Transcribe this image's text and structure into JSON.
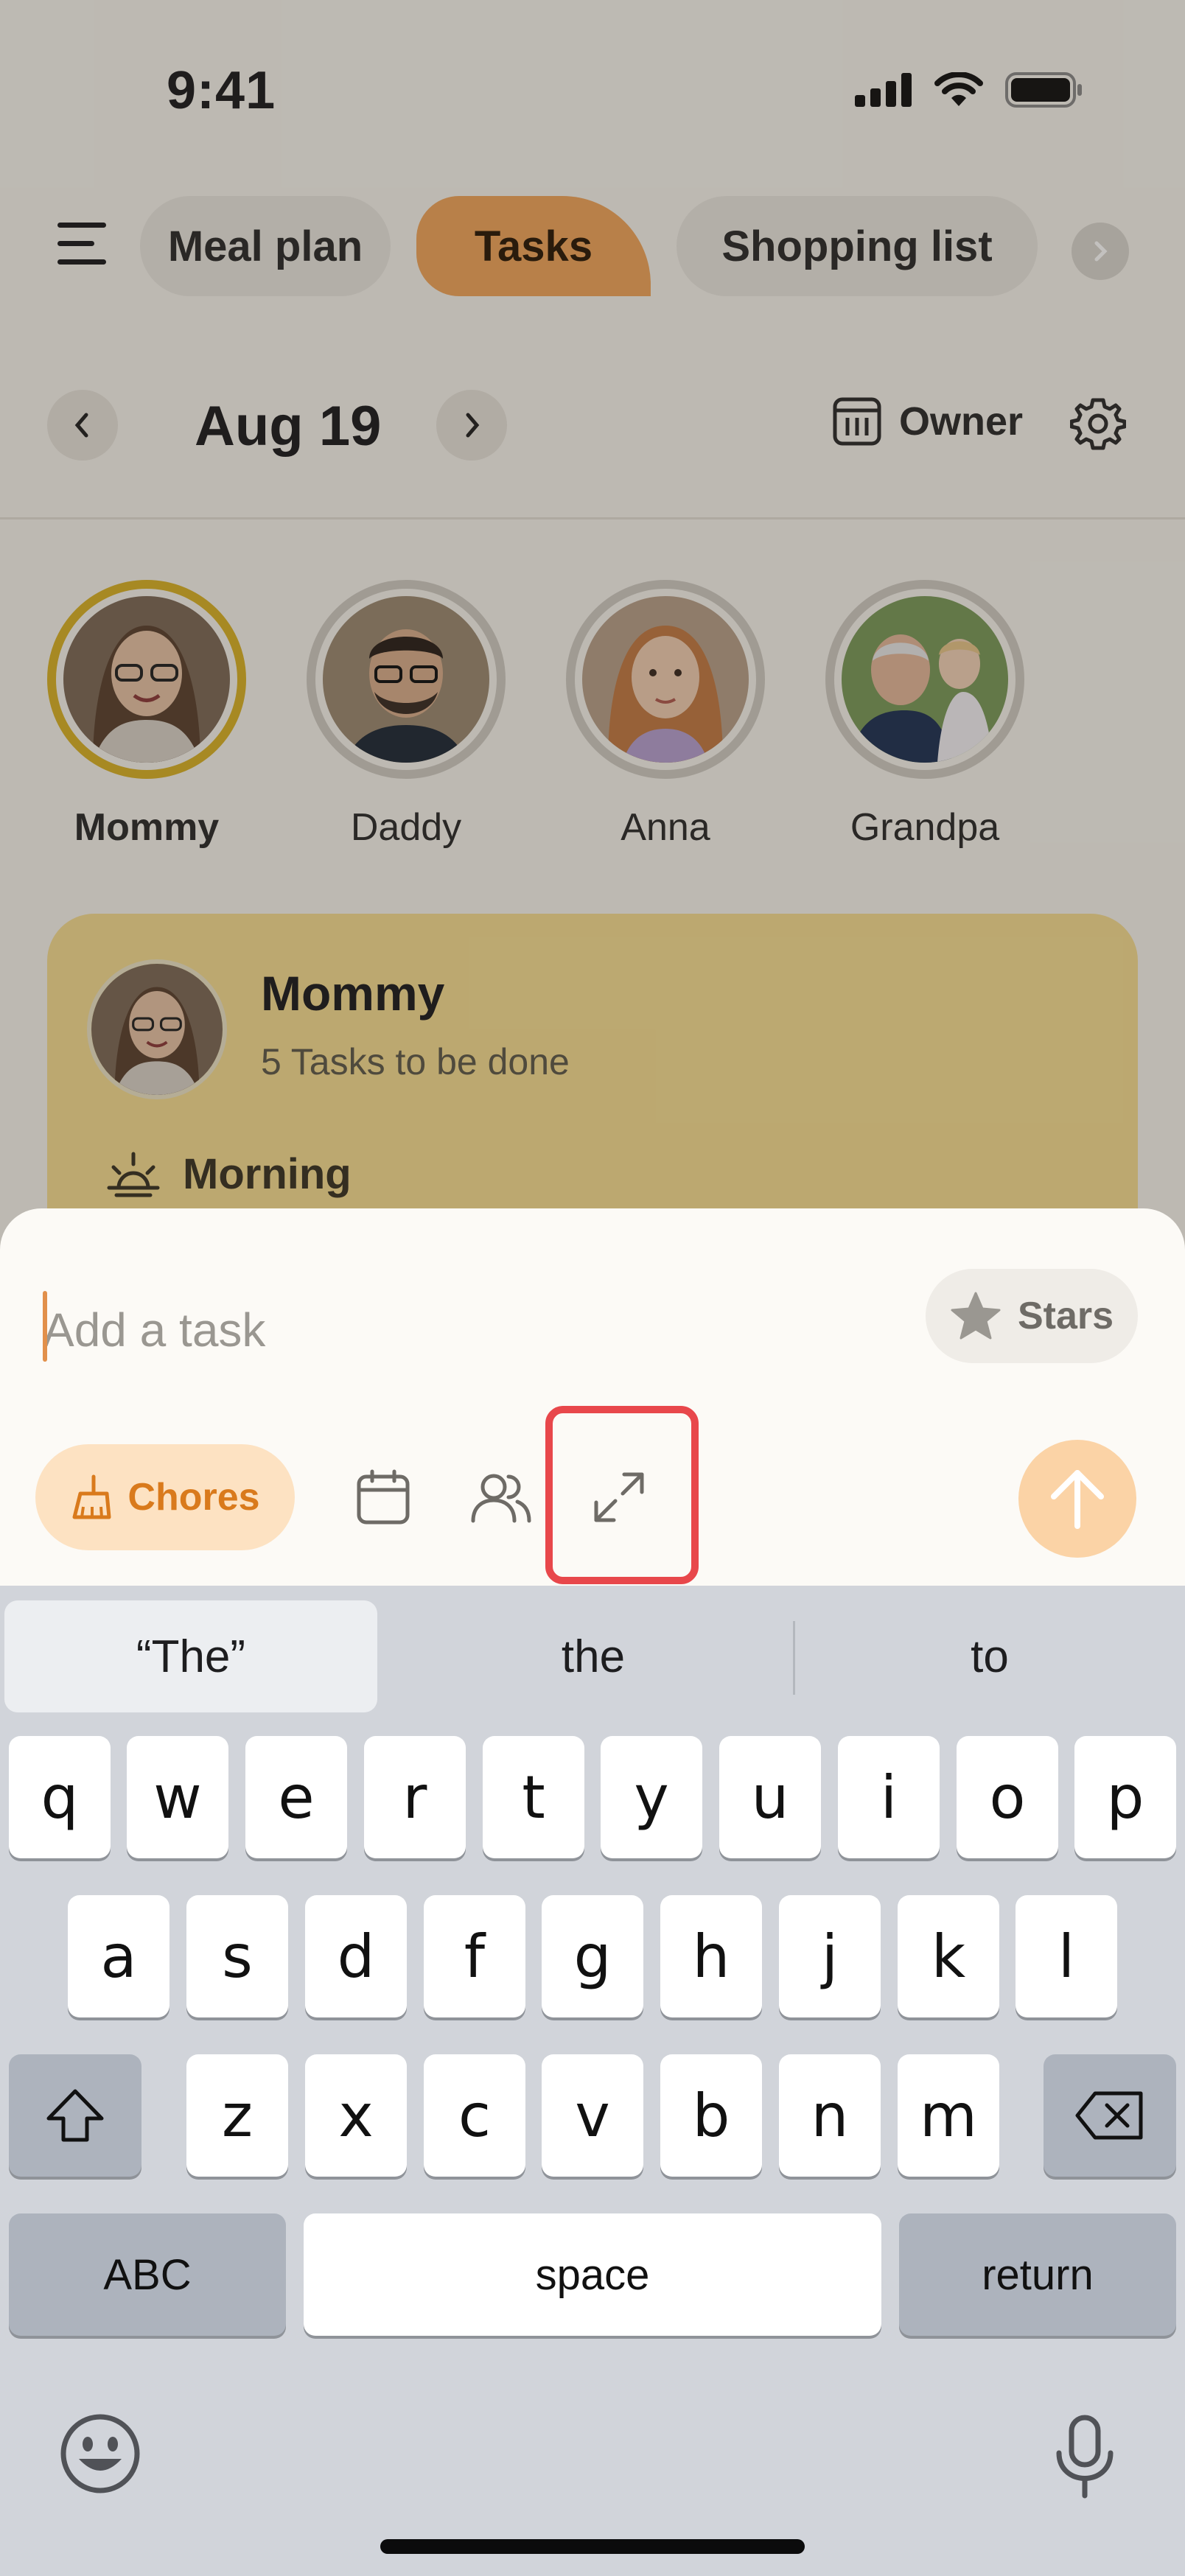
{
  "status_bar": {
    "time": "9:41"
  },
  "tabs": [
    {
      "label": "Meal plan",
      "selected": false
    },
    {
      "label": "Tasks",
      "selected": true
    },
    {
      "label": "Shopping list",
      "selected": false
    }
  ],
  "date_nav": {
    "date": "Aug 19",
    "owner_label": "Owner"
  },
  "members": [
    {
      "name": "Mommy",
      "selected": true
    },
    {
      "name": "Daddy",
      "selected": false
    },
    {
      "name": "Anna",
      "selected": false
    },
    {
      "name": "Grandpa",
      "selected": false
    }
  ],
  "card": {
    "name": "Mommy",
    "subtitle": "5 Tasks to be done",
    "section": "Morning"
  },
  "composer": {
    "placeholder": "Add a task",
    "value": "",
    "stars_label": "Stars",
    "category_label": "Chores"
  },
  "keyboard": {
    "suggestions": [
      "“The”",
      "the",
      "to"
    ],
    "row1": [
      "q",
      "w",
      "e",
      "r",
      "t",
      "y",
      "u",
      "i",
      "o",
      "p"
    ],
    "row2": [
      "a",
      "s",
      "d",
      "f",
      "g",
      "h",
      "j",
      "k",
      "l"
    ],
    "row3": [
      "z",
      "x",
      "c",
      "v",
      "b",
      "n",
      "m"
    ],
    "abc_label": "ABC",
    "space_label": "space",
    "return_label": "return"
  },
  "colors": {
    "accent": "#f0a65c",
    "chip_text": "#d97a1c",
    "highlight": "#e8474b",
    "card": "#f5dd92"
  },
  "icons": {
    "menu": "hamburger-icon",
    "calendar": "calendar-icon",
    "assignees": "people-icon",
    "expand": "expand-icon",
    "send": "arrow-up-icon"
  }
}
